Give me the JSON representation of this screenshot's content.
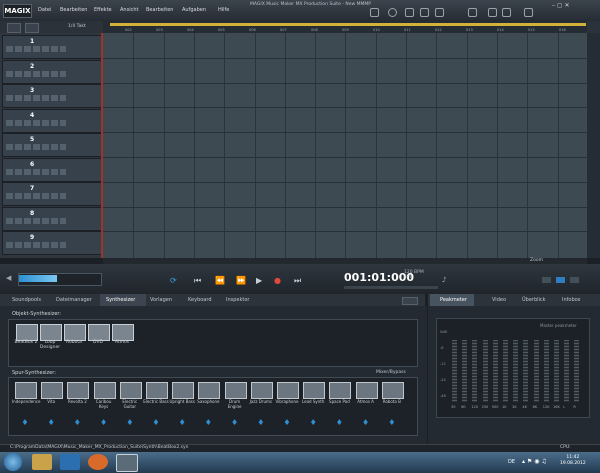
{
  "app": {
    "logo": "MAGIX",
    "window_title": "MAGIX Music Maker MX Production Suite - New MMMP"
  },
  "menu": [
    "Datei",
    "Bearbeiten",
    "Effekte",
    "Ansicht",
    "Bearbeiten",
    "Aufgaben",
    "Hilfe"
  ],
  "toolbar": {
    "zoom_label": "1/4 Takt"
  },
  "tracks": [
    "1",
    "2",
    "3",
    "4",
    "5",
    "6",
    "7",
    "8",
    "9"
  ],
  "ruler": [
    "002",
    "003",
    "004",
    "005",
    "006",
    "007",
    "008",
    "009",
    "010",
    "011",
    "012",
    "013",
    "014",
    "015",
    "016"
  ],
  "transport": {
    "timecode": "001:01:000",
    "tempo": "120",
    "tempo_unit": "BPM",
    "key": "4/4",
    "zoom": "Zoom"
  },
  "tabs": [
    "Soundpools",
    "Dateimanager",
    "Synthesizer",
    "Vorlagen",
    "Keyboard",
    "Inspektor"
  ],
  "active_tab": "Synthesizer",
  "right_tabs": [
    "Peakmeter",
    "Video",
    "Überblick",
    "Infobox"
  ],
  "active_right_tab": "Peakmeter",
  "object_synth": {
    "title": "Objekt-Synthesizer:",
    "items": [
      {
        "label": "BeatBox 2"
      },
      {
        "label": "Loop Designer"
      },
      {
        "label": "Robota"
      },
      {
        "label": "DVD"
      },
      {
        "label": "Atmos"
      }
    ]
  },
  "spur_synth": {
    "title": "Spur-Synthesizer:",
    "mix_button": "Mixer/Bypass",
    "items": [
      {
        "label": "Independence"
      },
      {
        "label": "Vita"
      },
      {
        "label": "Revolta 2"
      },
      {
        "label": "Caribou Keys"
      },
      {
        "label": "Electric Guitar"
      },
      {
        "label": "Electric Bass"
      },
      {
        "label": "Upright Bass"
      },
      {
        "label": "Saxophone"
      },
      {
        "label": "Drum Engine"
      },
      {
        "label": "Jazz Drums"
      },
      {
        "label": "Vibraphone"
      },
      {
        "label": "Lead Synth"
      },
      {
        "label": "Space Pad"
      },
      {
        "label": "Atmos A"
      },
      {
        "label": "Robota B"
      }
    ]
  },
  "peakmeter": {
    "title": "Master peakmeter",
    "bands": [
      "30",
      "60",
      "120",
      "250",
      "500",
      "1K",
      "2K",
      "4K",
      "8K",
      "12K",
      "16K",
      "L",
      "R"
    ],
    "levels": [
      0.88,
      0.88,
      0.88,
      0.88,
      0.88,
      0.88,
      0.88,
      0.88,
      0.88,
      0.88,
      0.88,
      0.88,
      0.88
    ],
    "scale": [
      "0dB",
      "-6",
      "-12",
      "-24",
      "-48"
    ]
  },
  "status": {
    "path": "C:\\ProgramData\\MAGIX\\Music_Maker_MX_Production_Suite\\Synth\\BeatBox2.syn",
    "cpu": "CPU:"
  },
  "taskbar": {
    "lang": "DE",
    "time": "11:42",
    "date": "19.08.2012"
  }
}
